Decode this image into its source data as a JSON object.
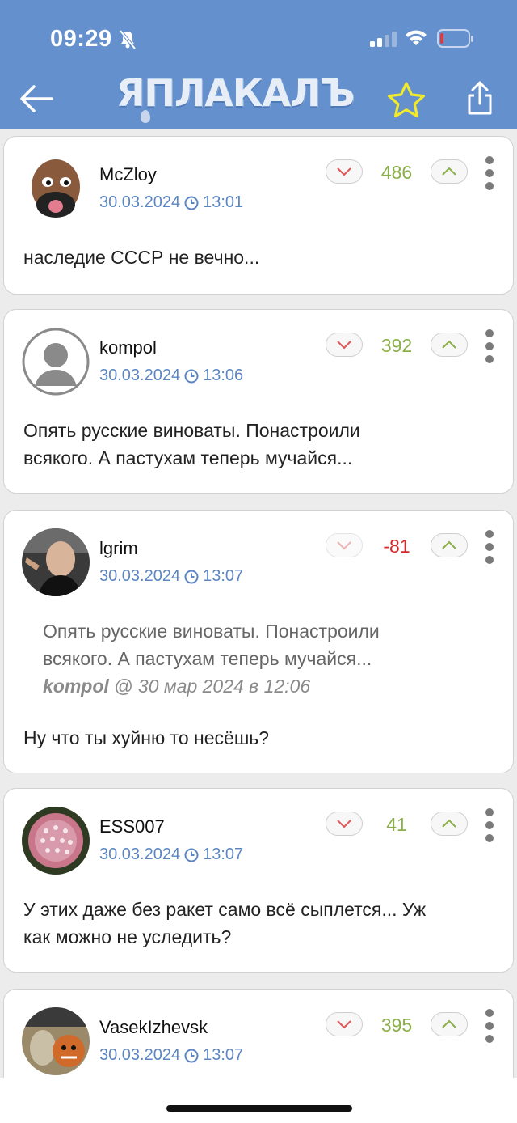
{
  "status": {
    "time": "09:29"
  },
  "header": {
    "logo": "ЯПЛАКАЛЪ"
  },
  "colors": {
    "topbar": "#6491cd",
    "positive": "#8bb04a",
    "negative": "#d42a2a",
    "meta": "#5b86c3"
  },
  "comments": [
    {
      "author": "McZloy",
      "date": "30.03.2024",
      "time": "13:01",
      "score": "486",
      "text": "наследие СССР не вечно..."
    },
    {
      "author": "kompol",
      "date": "30.03.2024",
      "time": "13:06",
      "score": "392",
      "text_l1": "Опять русские виноваты. Понастроили",
      "text_l2": "всякого. А пастухам теперь мучайся..."
    },
    {
      "author": "lgrim",
      "date": "30.03.2024",
      "time": "13:07",
      "score": "-81",
      "quote_l1": "Опять русские виноваты. Понастроили",
      "quote_l2": "всякого. А пастухам теперь мучайся...",
      "quote_author": "kompol",
      "quote_date": " @ 30 мар 2024 в 12:06",
      "text": "Ну что ты хуйню то несёшь?"
    },
    {
      "author": "ESS007",
      "date": "30.03.2024",
      "time": "13:07",
      "score": "41",
      "text_l1": "У этих даже без ракет само всё сыплется... Уж",
      "text_l2": "как можно не уследить?"
    },
    {
      "author": "VasekIzhevsk",
      "date": "30.03.2024",
      "time": "13:07",
      "score": "395"
    }
  ]
}
